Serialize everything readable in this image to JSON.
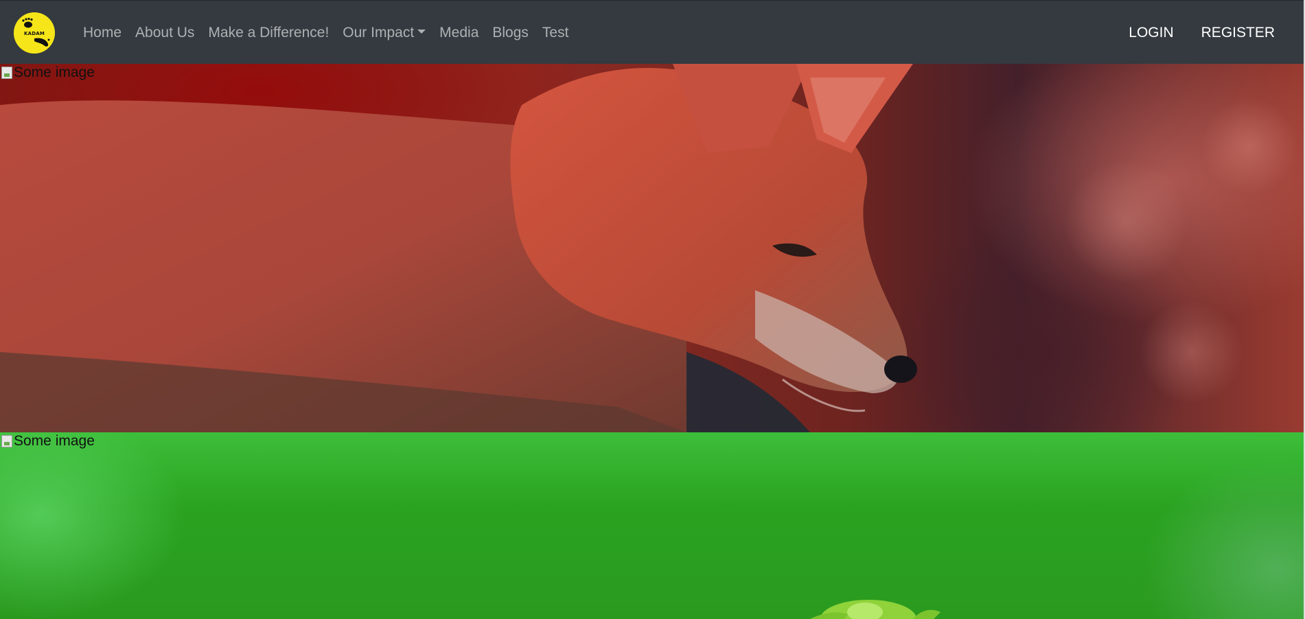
{
  "brand": {
    "logo_text": "KADAM"
  },
  "nav": {
    "links": [
      {
        "label": "Home"
      },
      {
        "label": "About Us"
      },
      {
        "label": "Make a Difference!"
      },
      {
        "label": "Our Impact",
        "dropdown": true
      },
      {
        "label": "Media"
      },
      {
        "label": "Blogs"
      },
      {
        "label": "Test"
      }
    ],
    "auth": {
      "login": "LOGIN",
      "register": "REGISTER"
    }
  },
  "carousel": {
    "slides": [
      {
        "alt": "Some image",
        "subject": "red fox"
      },
      {
        "alt": "Some image",
        "subject": "green foliage"
      }
    ]
  },
  "colors": {
    "navbar_bg": "#343a40",
    "nav_link": "rgba(255,255,255,0.6)",
    "logo_yellow": "#f6e519"
  }
}
